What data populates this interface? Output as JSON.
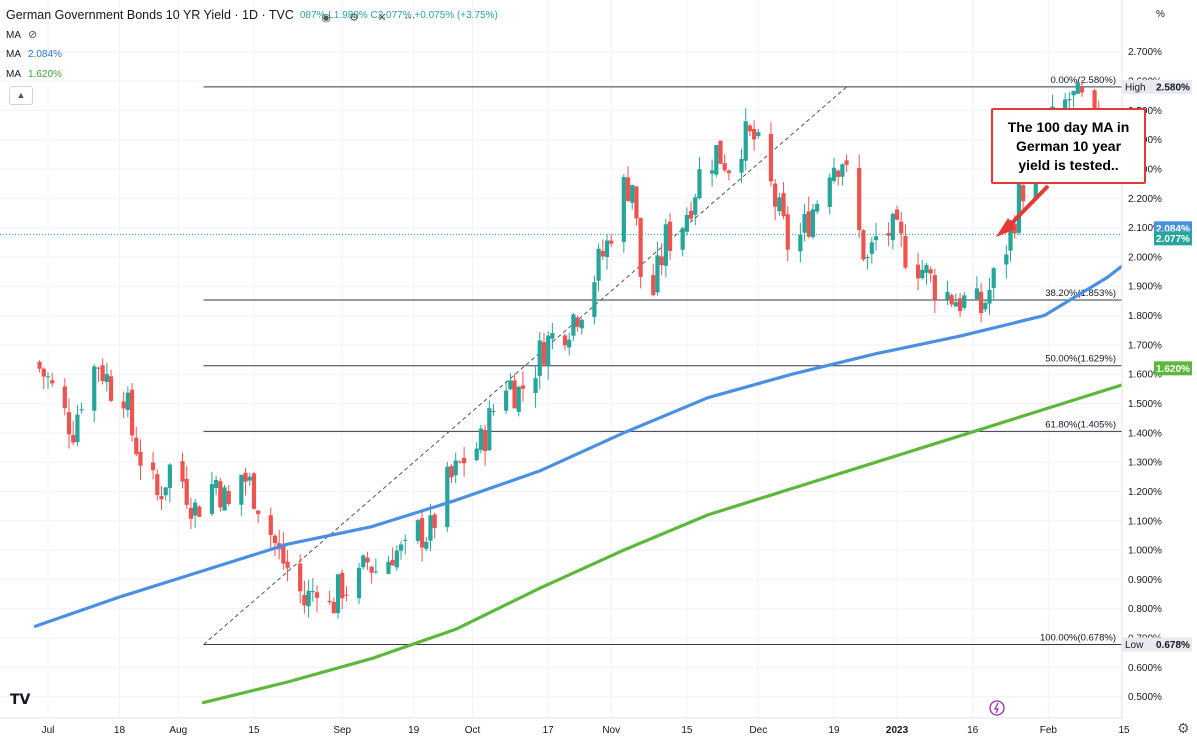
{
  "header": {
    "title": "German Government Bonds 10 YR Yield · 1D · TVC",
    "ohlc_text": "087% L1.980% C2.077% +0.075% (+3.75%)",
    "ma1_label": "MA",
    "ma1_value": "",
    "ma2_label": "MA",
    "ma2_value": "2.084%",
    "ma3_label": "MA",
    "ma3_value": "1.620%"
  },
  "annotation": {
    "text": "The 100 day MA in German 10 year yield is tested.."
  },
  "icons": [
    "eye-icon",
    "settings-icon",
    "close-icon",
    "more-icon",
    "collapse-icon",
    "tradingview-logo-icon",
    "gear-icon",
    "timezone-icon"
  ],
  "colors": {
    "up": "#26a69a",
    "down": "#ef5350",
    "ma100": "#4a90e2",
    "ma200": "#5cb83a",
    "callout": "#e53935"
  },
  "chart_data": {
    "type": "candlestick",
    "title": "German Government Bonds 10 YR Yield · 1D · TVC",
    "y_axis": {
      "unit": "%",
      "range": [
        0.45,
        2.78
      ],
      "ticks": [
        "2.700%",
        "2.600%",
        "2.500%",
        "2.400%",
        "2.300%",
        "2.200%",
        "2.100%",
        "2.000%",
        "1.900%",
        "1.800%",
        "1.700%",
        "1.600%",
        "1.500%",
        "1.400%",
        "1.300%",
        "1.200%",
        "1.100%",
        "1.000%",
        "0.900%",
        "0.800%",
        "0.700%",
        "0.600%",
        "0.500%"
      ],
      "tick_values": [
        2.7,
        2.6,
        2.5,
        2.4,
        2.3,
        2.2,
        2.1,
        2.0,
        1.9,
        1.8,
        1.7,
        1.6,
        1.5,
        1.4,
        1.3,
        1.2,
        1.1,
        1.0,
        0.9,
        0.8,
        0.7,
        0.6,
        0.5
      ]
    },
    "x_axis": {
      "labels": [
        "Jul",
        "18",
        "Aug",
        "15",
        "Sep",
        "19",
        "Oct",
        "17",
        "Nov",
        "15",
        "Dec",
        "19",
        "2023",
        "16",
        "Feb",
        "15"
      ],
      "label_days": [
        3,
        20,
        34,
        52,
        73,
        90,
        104,
        122,
        137,
        155,
        172,
        190,
        205,
        223,
        241,
        259
      ]
    },
    "price_labels": [
      {
        "text": "High",
        "value": "2.580%",
        "level": 2.58
      },
      {
        "text": "",
        "value": "2.084%",
        "level": 2.084
      },
      {
        "text": "",
        "value": "2.077%",
        "level": 2.077
      },
      {
        "text": "",
        "value": "1.620%",
        "level": 1.62
      },
      {
        "text": "Low",
        "value": "0.678%",
        "level": 0.678
      }
    ],
    "fib_levels": [
      {
        "label": "0.00%(2.580%)",
        "value": 2.58
      },
      {
        "label": "38.20%(1.853%)",
        "value": 1.853
      },
      {
        "label": "50.00%(1.629%)",
        "value": 1.629
      },
      {
        "label": "61.80%(1.405%)",
        "value": 1.405
      },
      {
        "label": "100.00%(0.678%)",
        "value": 0.678
      }
    ],
    "fib_trend": {
      "from": {
        "day": 40,
        "value": 0.678
      },
      "to": {
        "day": 193,
        "value": 2.58
      }
    },
    "current_price": 2.077,
    "close_path": [
      [
        0,
        1.64
      ],
      [
        3,
        1.58
      ],
      [
        6,
        1.48
      ],
      [
        9,
        1.42
      ],
      [
        12,
        1.58
      ],
      [
        15,
        1.64
      ],
      [
        18,
        1.56
      ],
      [
        20,
        1.62
      ],
      [
        23,
        1.4
      ],
      [
        26,
        1.28
      ],
      [
        29,
        1.18
      ],
      [
        32,
        1.28
      ],
      [
        35,
        1.24
      ],
      [
        38,
        1.14
      ],
      [
        41,
        1.2
      ],
      [
        43,
        1.24
      ],
      [
        46,
        1.14
      ],
      [
        49,
        1.26
      ],
      [
        52,
        1.2
      ],
      [
        55,
        1.1
      ],
      [
        58,
        0.98
      ],
      [
        61,
        0.92
      ],
      [
        64,
        0.82
      ],
      [
        66,
        0.86
      ],
      [
        68,
        0.94
      ],
      [
        70,
        0.8
      ],
      [
        73,
        0.88
      ],
      [
        76,
        0.86
      ],
      [
        79,
        0.96
      ],
      [
        82,
        0.92
      ],
      [
        85,
        1.0
      ],
      [
        88,
        0.98
      ],
      [
        91,
        1.06
      ],
      [
        94,
        1.06
      ],
      [
        97,
        1.2
      ],
      [
        100,
        1.26
      ],
      [
        103,
        1.34
      ],
      [
        106,
        1.36
      ],
      [
        109,
        1.48
      ],
      [
        112,
        1.58
      ],
      [
        115,
        1.54
      ],
      [
        118,
        1.6
      ],
      [
        121,
        1.7
      ],
      [
        124,
        1.74
      ],
      [
        127,
        1.78
      ],
      [
        130,
        1.84
      ],
      [
        133,
        1.94
      ],
      [
        136,
        2.04
      ],
      [
        139,
        2.22
      ],
      [
        142,
        2.26
      ],
      [
        144,
        1.94
      ],
      [
        147,
        1.88
      ],
      [
        150,
        2.06
      ],
      [
        153,
        2.08
      ],
      [
        156,
        2.2
      ],
      [
        159,
        2.32
      ],
      [
        162,
        2.36
      ],
      [
        165,
        2.32
      ],
      [
        168,
        2.4
      ],
      [
        171,
        2.4
      ],
      [
        174,
        2.28
      ],
      [
        177,
        2.14
      ],
      [
        180,
        2.0
      ],
      [
        183,
        2.1
      ],
      [
        186,
        2.2
      ],
      [
        189,
        2.32
      ],
      [
        192,
        2.34
      ],
      [
        195,
        2.12
      ],
      [
        198,
        1.98
      ],
      [
        201,
        2.1
      ],
      [
        204,
        2.08
      ],
      [
        207,
        2.02
      ],
      [
        210,
        1.98
      ],
      [
        213,
        1.92
      ],
      [
        216,
        1.88
      ],
      [
        219,
        1.86
      ],
      [
        222,
        1.84
      ],
      [
        225,
        1.82
      ],
      [
        228,
        1.92
      ],
      [
        231,
        2.04
      ],
      [
        234,
        2.2
      ],
      [
        237,
        2.32
      ],
      [
        240,
        2.4
      ],
      [
        243,
        2.48
      ],
      [
        246,
        2.54
      ],
      [
        249,
        2.52
      ],
      [
        252,
        2.44
      ],
      [
        255,
        2.36
      ],
      [
        258,
        2.28
      ],
      [
        261,
        2.24
      ],
      [
        264,
        2.18
      ],
      [
        267,
        2.14
      ],
      [
        270,
        2.08
      ]
    ],
    "series": [
      {
        "name": "MA",
        "value_label": "2.084%",
        "points": [
          [
            0,
            0.74
          ],
          [
            20,
            0.84
          ],
          [
            40,
            0.93
          ],
          [
            60,
            1.02
          ],
          [
            80,
            1.08
          ],
          [
            100,
            1.17
          ],
          [
            120,
            1.27
          ],
          [
            140,
            1.4
          ],
          [
            160,
            1.52
          ],
          [
            180,
            1.6
          ],
          [
            200,
            1.67
          ],
          [
            220,
            1.73
          ],
          [
            240,
            1.8
          ],
          [
            255,
            1.93
          ],
          [
            265,
            2.04
          ],
          [
            272,
            2.08
          ]
        ]
      },
      {
        "name": "MA",
        "value_label": "1.620%",
        "points": [
          [
            40,
            0.48
          ],
          [
            60,
            0.55
          ],
          [
            80,
            0.63
          ],
          [
            100,
            0.73
          ],
          [
            120,
            0.87
          ],
          [
            140,
            1.0
          ],
          [
            160,
            1.12
          ],
          [
            180,
            1.21
          ],
          [
            200,
            1.3
          ],
          [
            220,
            1.39
          ],
          [
            240,
            1.48
          ],
          [
            260,
            1.57
          ],
          [
            272,
            1.62
          ]
        ]
      }
    ]
  }
}
